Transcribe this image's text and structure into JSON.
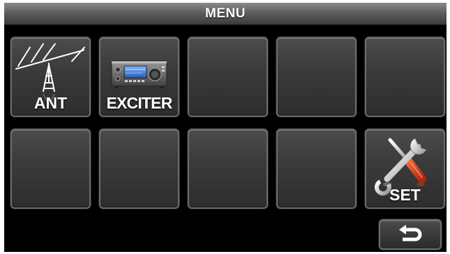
{
  "menu": {
    "title": "MENU"
  },
  "tiles": [
    {
      "label": "ANT",
      "icon": "antenna-icon"
    },
    {
      "label": "EXCITER",
      "icon": "transceiver-icon"
    },
    {
      "label": "",
      "icon": ""
    },
    {
      "label": "",
      "icon": ""
    },
    {
      "label": "",
      "icon": ""
    },
    {
      "label": "",
      "icon": ""
    },
    {
      "label": "",
      "icon": ""
    },
    {
      "label": "",
      "icon": ""
    },
    {
      "label": "",
      "icon": ""
    },
    {
      "label": "SET",
      "icon": "tools-icon"
    }
  ],
  "footer": {
    "back_icon": "return-arrow-icon"
  },
  "colors": {
    "screen_background": "#000000",
    "tile_border": "#6c6c6c",
    "label_text": "#ffffff",
    "wrench_handle": "#d8421f"
  }
}
